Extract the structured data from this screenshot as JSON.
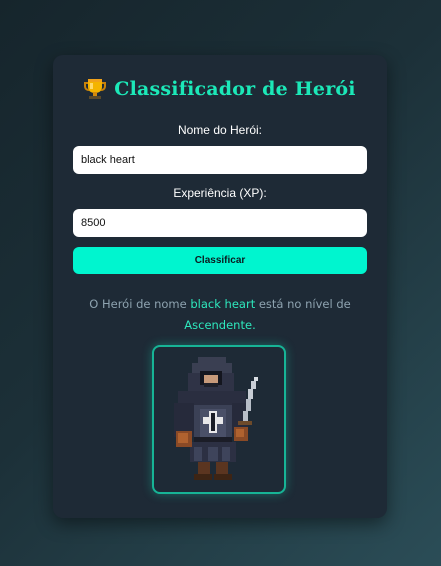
{
  "app": {
    "title": "Classificador de Herói",
    "icon": "trophy-icon"
  },
  "form": {
    "name_label": "Nome do Herói:",
    "name_value": "black heart",
    "xp_label": "Experiência (XP):",
    "xp_value": "8500",
    "submit_label": "Classificar"
  },
  "result": {
    "prefix": "O Herói de nome",
    "hero_name": "black heart",
    "middle": "está no nível de",
    "level": "Ascendente",
    "suffix": "."
  },
  "image": {
    "icon": "hooded-knight-sprite"
  },
  "colors": {
    "accent": "#00f5cf",
    "title": "#1ce8b8",
    "card": "#1e2a36"
  }
}
